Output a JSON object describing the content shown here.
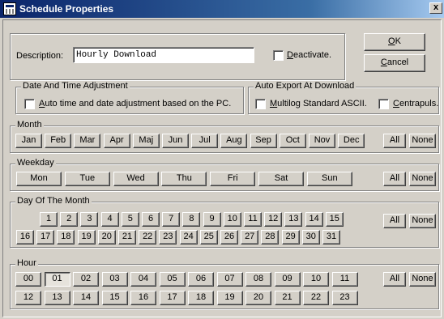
{
  "window": {
    "title": "Schedule Properties",
    "close": "x"
  },
  "description": {
    "label": "Description:",
    "value": "Hourly Download"
  },
  "deactivate": {
    "label": "Deactivate.",
    "checked": false
  },
  "buttons": {
    "ok": "OK",
    "cancel": "Cancel"
  },
  "datetime": {
    "title": "Date And Time Adjustment",
    "auto_label": "Auto time and date adjustment based on the PC.",
    "checked": false
  },
  "export": {
    "title": "Auto Export At Download",
    "multilog_label": "Multilog Standard ASCII.",
    "centrapuls_label": "Centrapuls.",
    "multilog_checked": false,
    "centrapuls_checked": false
  },
  "month": {
    "title": "Month",
    "items": [
      "Jan",
      "Feb",
      "Mar",
      "Apr",
      "Maj",
      "Jun",
      "Jul",
      "Aug",
      "Sep",
      "Oct",
      "Nov",
      "Dec"
    ],
    "all": "All",
    "none": "None"
  },
  "weekday": {
    "title": "Weekday",
    "items": [
      "Mon",
      "Tue",
      "Wed",
      "Thu",
      "Fri",
      "Sat",
      "Sun"
    ],
    "all": "All",
    "none": "None"
  },
  "dom": {
    "title": "Day Of The Month",
    "row1": [
      "1",
      "2",
      "3",
      "4",
      "5",
      "6",
      "7",
      "8",
      "9",
      "10",
      "11",
      "12",
      "13",
      "14",
      "15"
    ],
    "row2": [
      "16",
      "17",
      "18",
      "19",
      "20",
      "21",
      "22",
      "23",
      "24",
      "25",
      "26",
      "27",
      "28",
      "29",
      "30",
      "31"
    ],
    "all": "All",
    "none": "None"
  },
  "hour": {
    "title": "Hour",
    "row1": [
      "00",
      "01",
      "02",
      "03",
      "04",
      "05",
      "06",
      "07",
      "08",
      "09",
      "10",
      "11"
    ],
    "row2": [
      "12",
      "13",
      "14",
      "15",
      "16",
      "17",
      "18",
      "19",
      "20",
      "21",
      "22",
      "23"
    ],
    "pressed": [
      "01"
    ],
    "all": "All",
    "none": "None"
  }
}
